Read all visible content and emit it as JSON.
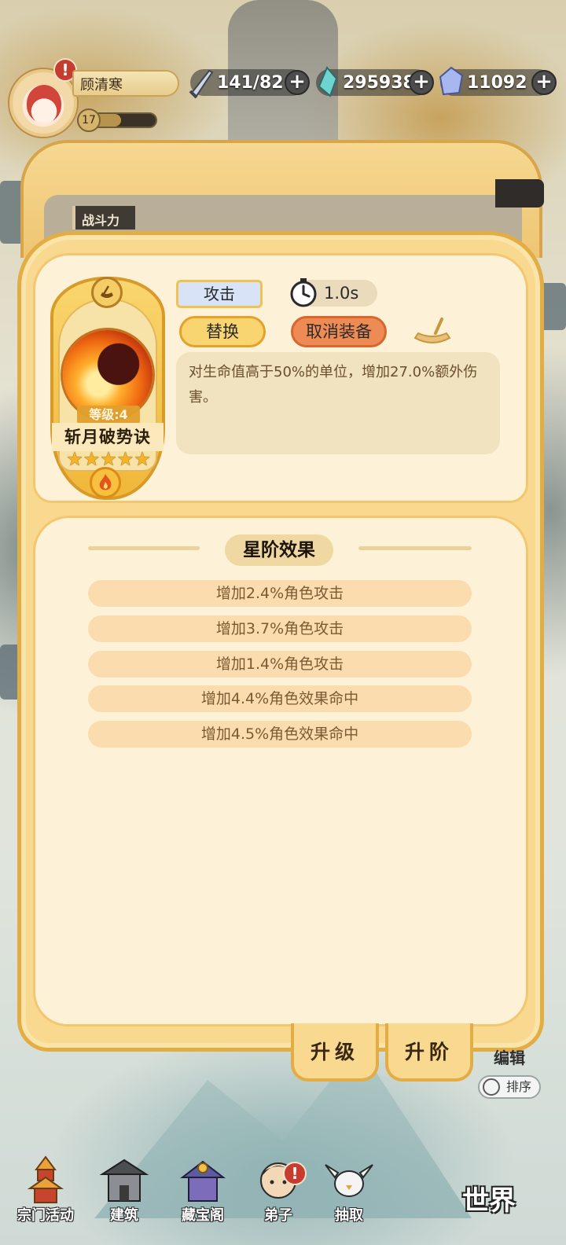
{
  "hud": {
    "player_name": "顾清寒",
    "level": "17",
    "alert": "!",
    "resources": [
      {
        "icon": "sword-icon",
        "value": "141/82"
      },
      {
        "icon": "jade-icon",
        "value": "295938"
      },
      {
        "icon": "crystal-icon",
        "value": "11092"
      }
    ],
    "plus": "+"
  },
  "back_panel": {
    "tab_label": "战斗力"
  },
  "skill": {
    "level_label": "等级:4",
    "name": "斩月破势诀",
    "stars": 5,
    "stars_text": "★★★★★",
    "type_tag": "攻击",
    "cooldown": "1.0s",
    "replace_label": "替换",
    "unequip_label": "取消装备",
    "description": "对生命值高于50%的单位，增加27.0%额外伤害。"
  },
  "effects": {
    "title": "星阶效果",
    "rows": [
      "增加2.4%角色攻击",
      "增加3.7%角色攻击",
      "增加1.4%角色攻击",
      "增加4.4%角色效果命中",
      "增加4.5%角色效果命中"
    ]
  },
  "actions": {
    "upgrade": "升级",
    "ascend": "升阶"
  },
  "side": {
    "edit": "编辑",
    "sort": "排序"
  },
  "nav": {
    "items": [
      "宗门活动",
      "建筑",
      "藏宝阁",
      "弟子",
      "抽取"
    ],
    "world": "世界",
    "disciple_alert": "!"
  },
  "colors": {
    "panel": "#f8d98f",
    "panel_border": "#e2ad45",
    "content_bg": "#fdf1d7",
    "effect_row": "#fbdcae",
    "unequip_button": "#ee8a54",
    "replace_button": "#f8d570",
    "attack_tag": "#d8e3f7"
  }
}
